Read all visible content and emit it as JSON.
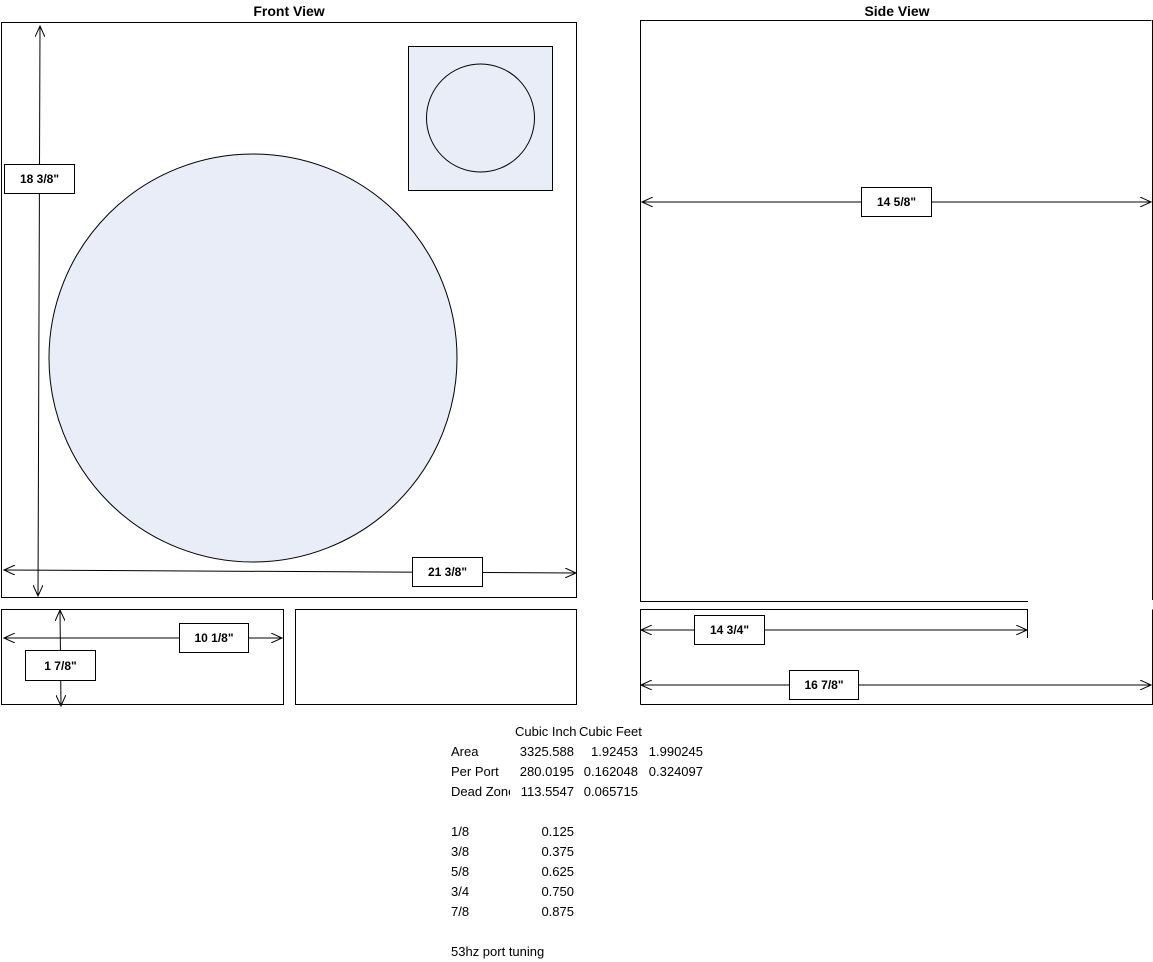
{
  "titles": {
    "front": "Front View",
    "side": "Side View"
  },
  "dimensions": {
    "front_height": "18 3/8\"",
    "front_width": "21 3/8\"",
    "side_width": "14 5/8\"",
    "bottom_left_width": "10 1/8\"",
    "bottom_left_height": "1 7/8\"",
    "side_bottom_inner": "14 3/4\"",
    "side_bottom_outer": "16 7/8\""
  },
  "table": {
    "headers": [
      "Cubic Inch",
      "Cubic Feet"
    ],
    "rows": [
      {
        "label": "Area",
        "v1": "3325.588",
        "v2": "1.92453",
        "v3": "1.990245"
      },
      {
        "label": "Per Port",
        "v1": "280.0195",
        "v2": "0.162048",
        "v3": "0.324097"
      },
      {
        "label": "Dead Zone",
        "v1": "113.5547",
        "v2": "0.065715",
        "v3": ""
      }
    ],
    "fractions": [
      {
        "frac": "1/8",
        "dec": "0.125"
      },
      {
        "frac": "3/8",
        "dec": "0.375"
      },
      {
        "frac": "5/8",
        "dec": "0.625"
      },
      {
        "frac": "3/4",
        "dec": "0.750"
      },
      {
        "frac": "7/8",
        "dec": "0.875"
      }
    ],
    "note": "53hz port tuning"
  },
  "colors": {
    "fill": "#e8edf7",
    "line": "#000000"
  }
}
